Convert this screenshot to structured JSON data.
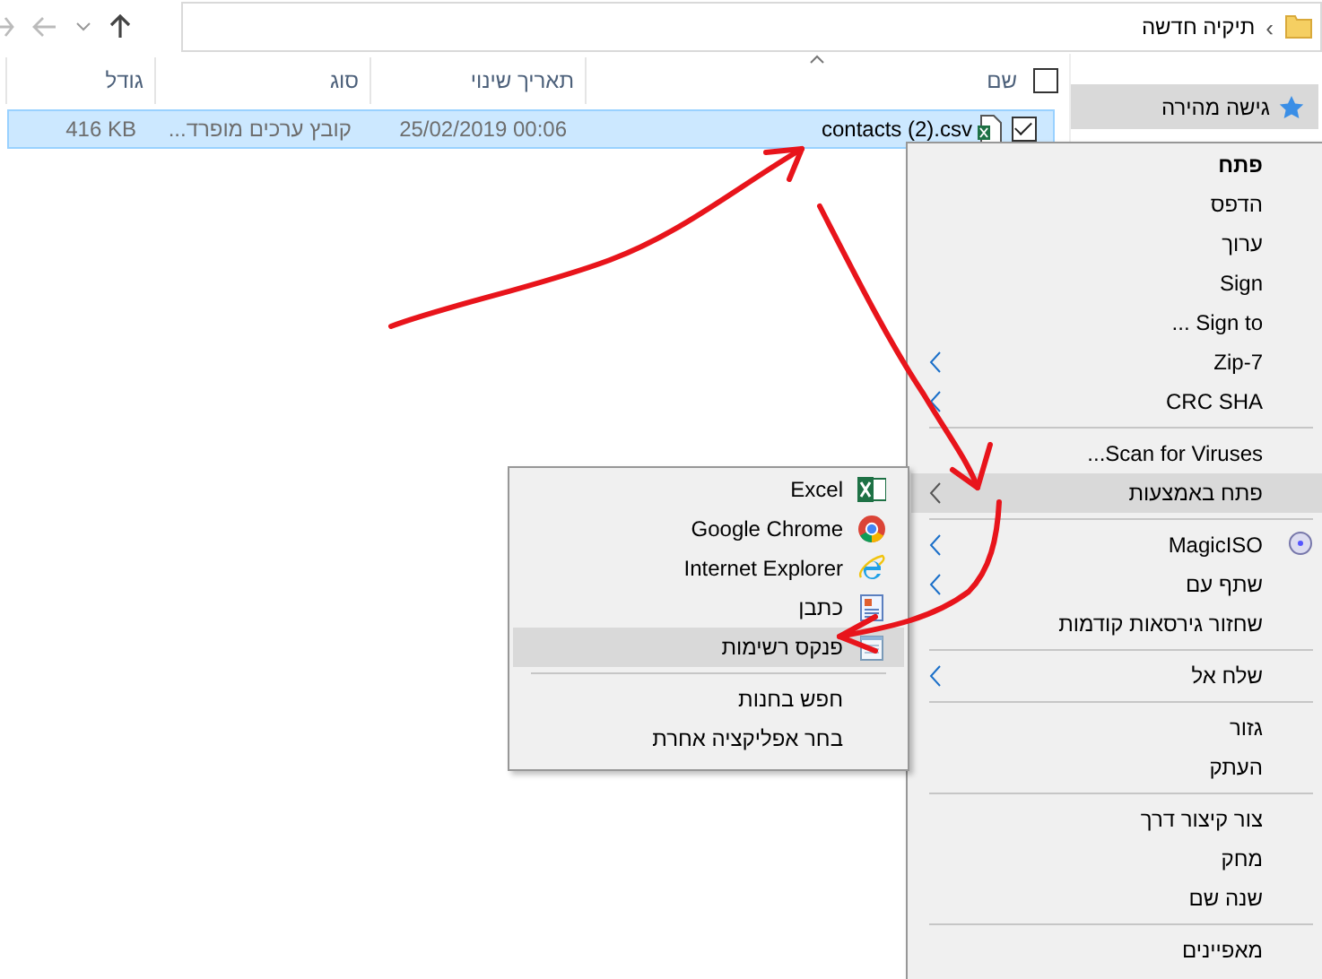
{
  "address_bar": {
    "breadcrumb": "תיקיה חדשה",
    "separator": "›"
  },
  "sidebar": {
    "items": [
      {
        "label": "גישה מהירה",
        "selected": true
      }
    ]
  },
  "file_list": {
    "select_all_checked": false,
    "columns": [
      "שם",
      "תאריך שינוי",
      "סוג",
      "גודל"
    ],
    "rows": [
      {
        "name": "contacts (2).csv",
        "date": "25/02/2019 00:06",
        "type": "קובץ ערכים מופרד...",
        "size": "416 KB",
        "selected": true,
        "checked": true
      }
    ]
  },
  "context_menu": {
    "items": [
      {
        "kind": "item",
        "label": "פתח",
        "default": true,
        "submenu": false,
        "selected": false
      },
      {
        "kind": "item",
        "label": "הדפס",
        "default": false,
        "submenu": false,
        "selected": false
      },
      {
        "kind": "item",
        "label": "ערוך",
        "default": false,
        "submenu": false,
        "selected": false
      },
      {
        "kind": "item",
        "label": "Sign",
        "default": false,
        "submenu": false,
        "selected": false
      },
      {
        "kind": "item",
        "label": "Sign to ...",
        "default": false,
        "submenu": false,
        "selected": false
      },
      {
        "kind": "item",
        "label": "7-Zip",
        "default": false,
        "submenu": true,
        "selected": false
      },
      {
        "kind": "item",
        "label": "CRC SHA",
        "default": false,
        "submenu": true,
        "selected": false
      },
      {
        "kind": "separator"
      },
      {
        "kind": "item",
        "label": "Scan for Viruses...",
        "default": false,
        "submenu": false,
        "selected": false
      },
      {
        "kind": "item",
        "label": "פתח באמצעות",
        "default": false,
        "submenu": true,
        "selected": true
      },
      {
        "kind": "separator"
      },
      {
        "kind": "item",
        "label": "MagicISO",
        "default": false,
        "submenu": true,
        "selected": false
      },
      {
        "kind": "item",
        "label": "שתף עם",
        "default": false,
        "submenu": true,
        "selected": false
      },
      {
        "kind": "item",
        "label": "שחזור גירסאות קודמות",
        "default": false,
        "submenu": false,
        "selected": false
      },
      {
        "kind": "separator"
      },
      {
        "kind": "item",
        "label": "שלח אל",
        "default": false,
        "submenu": true,
        "selected": false
      },
      {
        "kind": "separator"
      },
      {
        "kind": "item",
        "label": "גזור",
        "default": false,
        "submenu": false,
        "selected": false
      },
      {
        "kind": "item",
        "label": "העתק",
        "default": false,
        "submenu": false,
        "selected": false
      },
      {
        "kind": "separator"
      },
      {
        "kind": "item",
        "label": "צור קיצור דרך",
        "default": false,
        "submenu": false,
        "selected": false
      },
      {
        "kind": "item",
        "label": "מחק",
        "default": false,
        "submenu": false,
        "selected": false
      },
      {
        "kind": "item",
        "label": "שנה שם",
        "default": false,
        "submenu": false,
        "selected": false
      },
      {
        "kind": "separator"
      },
      {
        "kind": "item",
        "label": "מאפיינים",
        "default": false,
        "submenu": false,
        "selected": false
      }
    ]
  },
  "open_with_menu": {
    "items": [
      {
        "kind": "item",
        "label": "Excel",
        "default": false,
        "submenu": false,
        "selected": false
      },
      {
        "kind": "item",
        "label": "Google Chrome",
        "default": false,
        "submenu": false,
        "selected": false
      },
      {
        "kind": "item",
        "label": "Internet Explorer",
        "default": false,
        "submenu": false,
        "selected": false
      },
      {
        "kind": "item",
        "label": "כתבן",
        "default": false,
        "submenu": false,
        "selected": false
      },
      {
        "kind": "item",
        "label": "פנקס רשימות",
        "default": false,
        "submenu": false,
        "selected": true
      },
      {
        "kind": "separator"
      },
      {
        "kind": "item",
        "label": "חפש בחנות",
        "default": false,
        "submenu": false,
        "selected": false
      },
      {
        "kind": "item",
        "label": "בחר אפליקציה אחרת",
        "default": false,
        "submenu": false,
        "selected": false
      }
    ]
  }
}
